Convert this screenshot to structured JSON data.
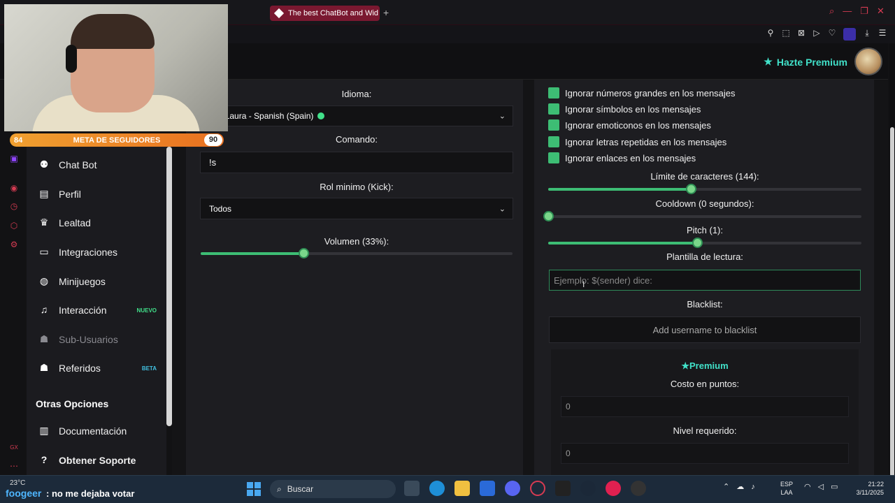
{
  "browser": {
    "tab_title": "The best ChatBot and Wid",
    "new_tab": "+"
  },
  "header": {
    "premium_link": "Hazte Premium"
  },
  "stream_overlay": {
    "goal_start": "84",
    "goal_label": "META DE SEGUIDORES",
    "goal_end": "90",
    "chat_user": "foogeer",
    "chat_message": ": no me dejaba votar"
  },
  "sidebar": {
    "items": [
      {
        "label": "Chat Bot",
        "icon": "robot-icon"
      },
      {
        "label": "Perfil",
        "icon": "id-card-icon"
      },
      {
        "label": "Lealtad",
        "icon": "trophy-icon"
      },
      {
        "label": "Integraciones",
        "icon": "plug-icon"
      },
      {
        "label": "Minijuegos",
        "icon": "gamepad-icon"
      },
      {
        "label": "Interacción",
        "icon": "music-note-icon",
        "tag": "NUEVO"
      },
      {
        "label": "Sub-Usuarios",
        "icon": "users-icon"
      },
      {
        "label": "Referidos",
        "icon": "user-group-icon",
        "tag": "BETA"
      }
    ],
    "other_section_title": "Otras Opciones",
    "other_items": [
      {
        "label": "Documentación",
        "icon": "book-icon"
      },
      {
        "label": "Obtener Soporte",
        "icon": "help-icon"
      }
    ]
  },
  "left_panel": {
    "language_label": "Idioma:",
    "language_value": "soft Laura - Spanish (Spain)",
    "command_label": "Comando:",
    "command_value": "!s",
    "role_label": "Rol minimo (Kick):",
    "role_value": "Todos",
    "volume_label": "Volumen (33%):",
    "volume_value": 0.33
  },
  "right_panel": {
    "checkboxes": [
      "Ignorar números grandes en los mensajes",
      "Ignorar símbolos en los mensajes",
      "Ignorar emoticonos en los mensajes",
      "Ignorar letras repetidas en los mensajes",
      "Ignorar enlaces en los mensajes"
    ],
    "char_limit_label": "Límite de caracteres (144):",
    "char_limit_value": 0.455,
    "cooldown_label": "Cooldown (0 segundos):",
    "cooldown_value": 0,
    "pitch_label": "Pitch (1):",
    "pitch_value": 0.475,
    "template_label": "Plantilla de lectura:",
    "template_placeholder": "Ejemplo: $(sender) dice:",
    "blacklist_label": "Blacklist:",
    "blacklist_placeholder": "Add username to blacklist",
    "premium_title": "Premium",
    "cost_label": "Costo en puntos:",
    "cost_value": "0",
    "level_label": "Nivel requerido:",
    "level_value": "0"
  },
  "taskbar": {
    "weather": "23°C",
    "search_placeholder": "Buscar",
    "lang_line1": "ESP",
    "lang_line2": "LAA",
    "time": "21:22",
    "date": "3/11/2025"
  }
}
